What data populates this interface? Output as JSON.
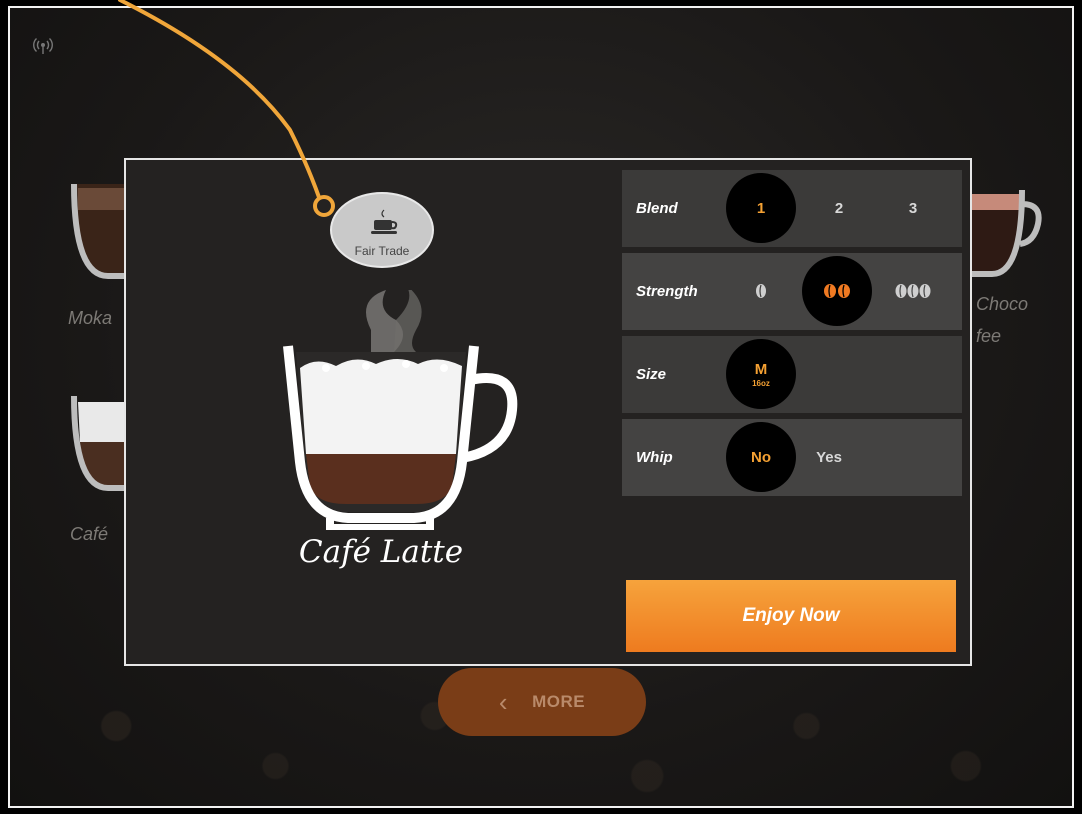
{
  "background": {
    "items": [
      {
        "label": "Moka"
      },
      {
        "label": "Café"
      },
      {
        "label": "Choco"
      },
      {
        "label": "fee"
      }
    ],
    "more_label": "MORE"
  },
  "drink": {
    "name": "Café Latte",
    "badge": "Fair Trade"
  },
  "options": {
    "blend": {
      "label": "Blend",
      "choices": [
        "1",
        "2",
        "3"
      ],
      "selected": "1"
    },
    "strength": {
      "label": "Strength",
      "choices": [
        "mild",
        "medium",
        "strong"
      ],
      "selected": "medium"
    },
    "size": {
      "label": "Size",
      "value": "M",
      "sub": "16oz"
    },
    "whip": {
      "label": "Whip",
      "choices": [
        "No",
        "Yes"
      ],
      "selected": "No"
    }
  },
  "enjoy_label": "Enjoy Now",
  "colors": {
    "accent": "#f5a133",
    "button": "#ee7b1f",
    "annotation": "#f0a63a"
  }
}
